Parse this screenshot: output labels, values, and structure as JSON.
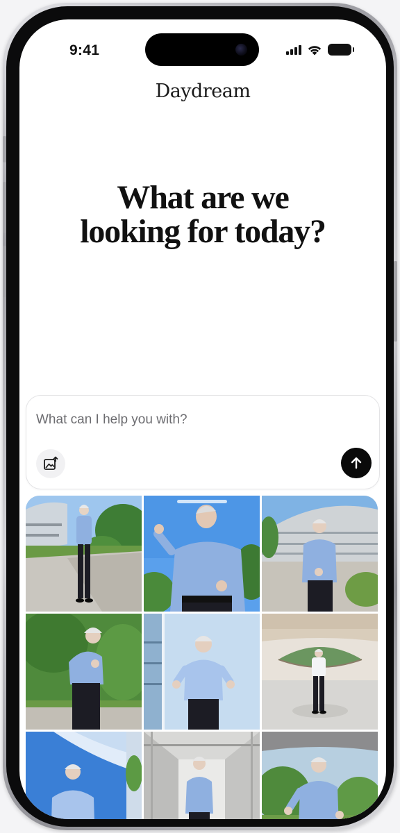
{
  "status_bar": {
    "time": "9:41",
    "icons": [
      "cellular-signal-icon",
      "wifi-icon",
      "battery-icon"
    ]
  },
  "app": {
    "title": "Daydream"
  },
  "main": {
    "headline_line1": "What are we",
    "headline_line2": "looking for today?"
  },
  "prompt": {
    "placeholder": "What can I help you with?",
    "value": "",
    "add_image_icon": "photo-add-icon",
    "send_icon": "arrow-up-icon"
  },
  "gallery": {
    "photo_count": 9,
    "photo_subject": "Man in light blue shirt and dark trousers"
  },
  "colors": {
    "background": "#ffffff",
    "text": "#111111",
    "placeholder": "#6c6c70",
    "send_button": "#0a0a0a",
    "shirt": "#8fb0e0"
  }
}
